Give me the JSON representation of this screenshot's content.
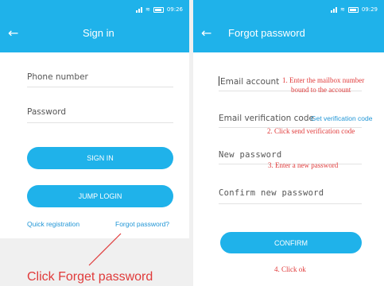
{
  "sign_in_screen": {
    "status_time": "09:26",
    "title": "Sign in",
    "phone_placeholder": "Phone number",
    "password_placeholder": "Password",
    "sign_in_button": "SIGN IN",
    "jump_login_button": "JUMP LOGIN",
    "quick_registration_link": "Quick registration",
    "forgot_password_link": "Forgot password?"
  },
  "forgot_password_screen": {
    "status_time": "09:29",
    "title": "Forgot password",
    "email_label": "Email account",
    "email_verification_label": "Email verification code",
    "send_code_link": "Get verification code",
    "new_password_label": "New password",
    "confirm_password_label": "Confirm new password",
    "confirm_button": "CONFIRM"
  },
  "annotations": {
    "step1_line1": "1. Enter the mailbox number",
    "step1_line2": "bound to the account",
    "step2": "2. Click send verification code",
    "step3": "3. Enter a new password",
    "step4": "4. Click ok",
    "caption": "Click Forget password"
  },
  "colors": {
    "accent": "#1fb2ea",
    "link": "#2196d6",
    "annotation": "#e03a3a"
  }
}
